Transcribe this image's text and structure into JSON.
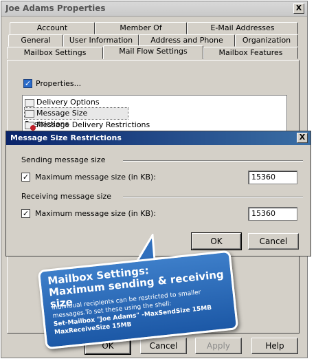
{
  "window": {
    "title": "Joe Adams Properties",
    "close": "X"
  },
  "tabs": {
    "row1": [
      "Account",
      "Member Of",
      "E-Mail Addresses"
    ],
    "row2": [
      "General",
      "User Information",
      "Address and Phone",
      "Organization"
    ],
    "row3": [
      "Mailbox Settings",
      "Mail Flow Settings",
      "Mailbox Features"
    ],
    "active": "Mail Flow Settings"
  },
  "properties_button": "Properties...",
  "list": [
    {
      "label": "Delivery Options",
      "icon": "delivery-options-icon"
    },
    {
      "label": "Message Size Restrictions",
      "icon": "size-restrictions-icon"
    },
    {
      "label": "Message Delivery Restrictions",
      "icon": "delivery-restrictions-icon"
    }
  ],
  "dialog": {
    "title": "Message Size Restrictions",
    "close": "X",
    "sending_section": "Sending message size",
    "sending_label": "Maximum message size (in KB):",
    "sending_value": "15360",
    "receiving_section": "Receiving message size",
    "receiving_label": "Maximum message size (in KB):",
    "receiving_value": "15360",
    "ok": "OK",
    "cancel": "Cancel"
  },
  "callout": {
    "line1": "Mailbox Settings:",
    "line2": "Maximum sending & receiving size",
    "text1": "Individual recipients can be restricted to smaller messages.To set these using the shell:",
    "cmd": "Set-Mailbox \"Joe Adams\" -MaxSendSize 15MB MaxReceiveSize 15MB"
  },
  "buttons": {
    "ok": "OK",
    "cancel": "Cancel",
    "apply": "Apply",
    "help": "Help"
  },
  "colors": {
    "dialog_title_bar": "#0a246a",
    "callout_blue": "#1c58a6"
  }
}
